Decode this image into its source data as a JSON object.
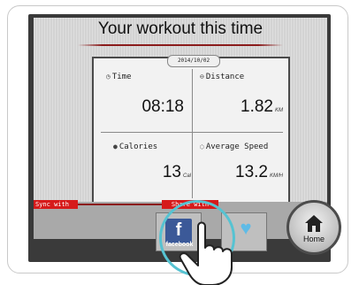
{
  "title": "Your workout this time",
  "date": "2014/10/02",
  "stats": [
    {
      "label": "Time",
      "value": "08:18",
      "unit": "",
      "icon": "clock-icon"
    },
    {
      "label": "Distance",
      "value": "1.82",
      "unit": "KM",
      "icon": "shoe-icon"
    },
    {
      "label": "Calories",
      "value": "13",
      "unit": "Cal",
      "icon": "flame-icon"
    },
    {
      "label": "Average Speed",
      "value": "13.2",
      "unit": "KM/H",
      "icon": "speed-icon"
    }
  ],
  "sync_label": "Sync with",
  "share_label": "Share with",
  "facebook_label": "facebook",
  "home_label": "Home",
  "colors": {
    "accent_red": "#d61b1b",
    "facebook_blue": "#3b5998",
    "twitter_blue": "#5fbbe6",
    "touch_ring": "#56c3d2"
  }
}
